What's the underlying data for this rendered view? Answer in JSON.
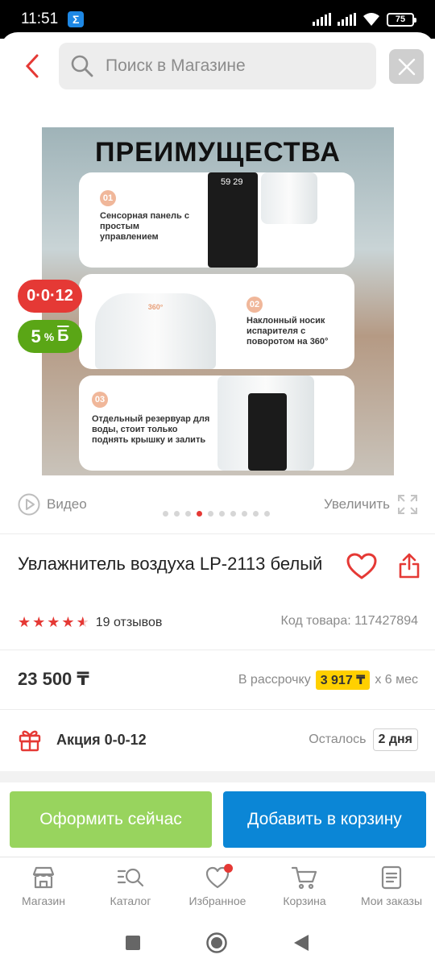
{
  "status_bar": {
    "time": "11:51",
    "app_badge": "Σ",
    "battery": "75"
  },
  "header": {
    "search_placeholder": "Поиск в Магазине"
  },
  "gallery": {
    "banner_title": "ПРЕИМУЩЕСТВА",
    "features": [
      {
        "num": "01",
        "text": "Сенсорная панель с простым управлением"
      },
      {
        "num": "02",
        "text": "Наклонный носик испарителя с поворотом на 360°"
      },
      {
        "num": "03",
        "text": "Отдельный резервуар для воды, стоит только поднять крышку и залить"
      }
    ],
    "display_readout": "59 29",
    "nozzle_label": "360°",
    "badge_installment": "0·0·12",
    "badge_bonus_percent": "5",
    "badge_bonus_unit": "%",
    "badge_bonus_letter": "Б",
    "video_label": "Видео",
    "zoom_label": "Увеличить",
    "dots_count": 10,
    "active_dot": 3
  },
  "product": {
    "title": "Увлажнитель воздуха LP-2113 белый",
    "rating": 4.5,
    "reviews": "19 отзывов",
    "sku": "Код товара: 117427894",
    "price": "23 500 ₸",
    "installment_prefix": "В рассрочку",
    "installment_amount": "3 917 ₸",
    "installment_suffix": "x 6 мес",
    "promo_label": "Акция 0-0-12",
    "remain_label": "Осталось",
    "remain_days": "2 дня"
  },
  "actions": {
    "buy_now": "Оформить сейчас",
    "add_to_cart": "Добавить в корзину"
  },
  "tabs": [
    {
      "label": "Магазин",
      "icon": "store-icon"
    },
    {
      "label": "Каталог",
      "icon": "catalog-search-icon"
    },
    {
      "label": "Избранное",
      "icon": "heart-icon"
    },
    {
      "label": "Корзина",
      "icon": "cart-icon"
    },
    {
      "label": "Мои заказы",
      "icon": "orders-icon"
    }
  ],
  "colors": {
    "accent_red": "#e53935",
    "buy_green": "#98d45e",
    "cart_blue": "#0b86d6",
    "installment_yellow": "#ffd000",
    "bonus_green": "#5aa616"
  }
}
